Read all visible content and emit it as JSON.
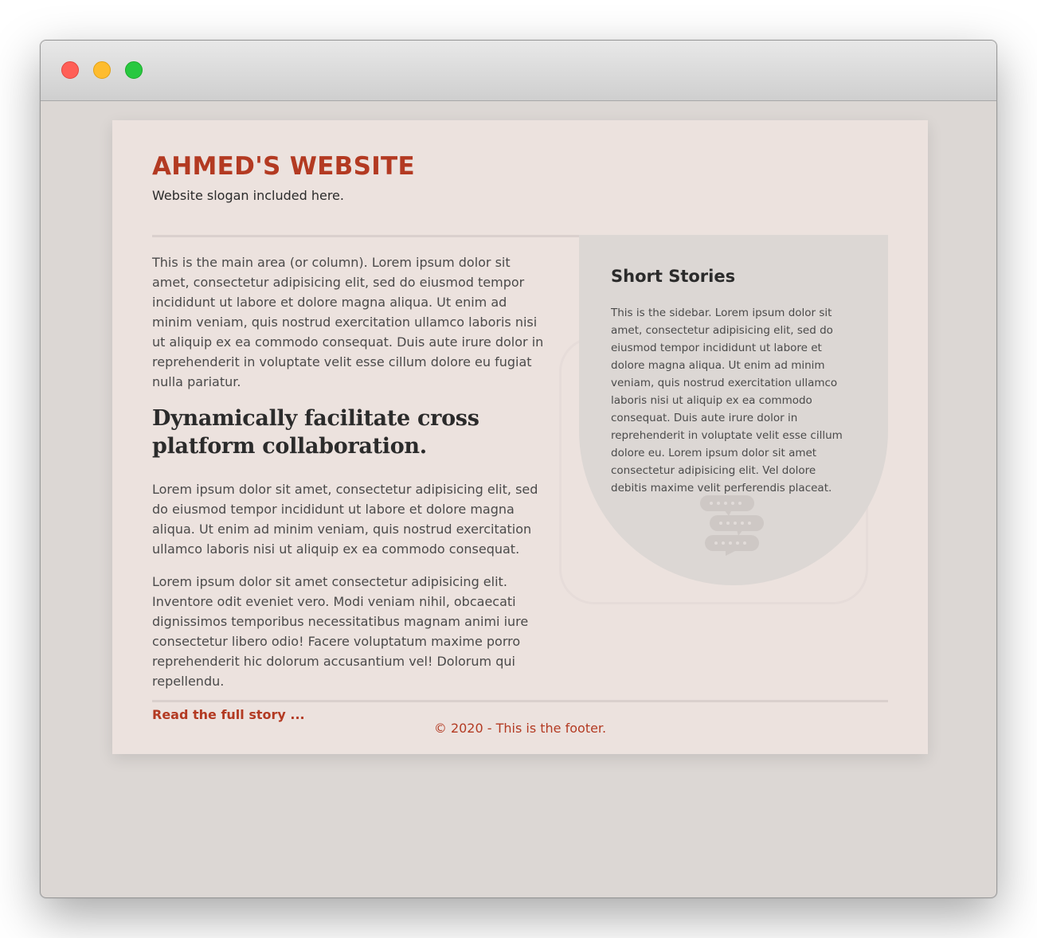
{
  "site": {
    "title": "AHMED'S WEBSITE",
    "slogan": "Website slogan included here."
  },
  "main": {
    "intro": "This is the main area (or column). Lorem ipsum dolor sit amet, consectetur adipisicing elit, sed do eiusmod tempor incididunt ut labore et dolore magna aliqua. Ut enim ad minim veniam, quis nostrud exercitation ullamco laboris nisi ut aliquip ex ea commodo consequat. Duis aute irure dolor in reprehenderit in voluptate velit esse cillum dolore eu fugiat nulla pariatur.",
    "heading": "Dynamically facilitate cross platform collaboration.",
    "paragraph1": "Lorem ipsum dolor sit amet, consectetur adipisicing elit, sed do eiusmod tempor incididunt ut labore et dolore magna aliqua. Ut enim ad minim veniam, quis nostrud exercitation ullamco laboris nisi ut aliquip ex ea commodo consequat.",
    "paragraph2": "Lorem ipsum dolor sit amet consectetur adipisicing elit. Inventore odit eveniet vero. Modi veniam nihil, obcaecati dignissimos temporibus necessitatibus magnam animi iure consectetur libero odio! Facere voluptatum maxime porro reprehenderit hic dolorum accusantium vel! Dolorum qui repellendu.",
    "read_more": "Read the full story ..."
  },
  "sidebar": {
    "title": "Short Stories",
    "text": "This is the sidebar. Lorem ipsum dolor sit amet, consectetur adipisicing elit, sed do eiusmod tempor incididunt ut labore et dolore magna aliqua. Ut enim ad minim veniam, quis nostrud exercitation ullamco laboris nisi ut aliquip ex ea commodo consequat. Duis aute irure dolor in reprehenderit in voluptate velit esse cillum dolore eu. Lorem ipsum dolor sit amet consectetur adipisicing elit. Vel dolore debitis maxime velit perferendis placeat.",
    "icon": "chat-bubbles-icon"
  },
  "footer": {
    "text": "© 2020 - This is the footer."
  },
  "colors": {
    "accent": "#b33a22",
    "page_background": "#ece2de",
    "sidebar_background": "#dcd7d4"
  }
}
